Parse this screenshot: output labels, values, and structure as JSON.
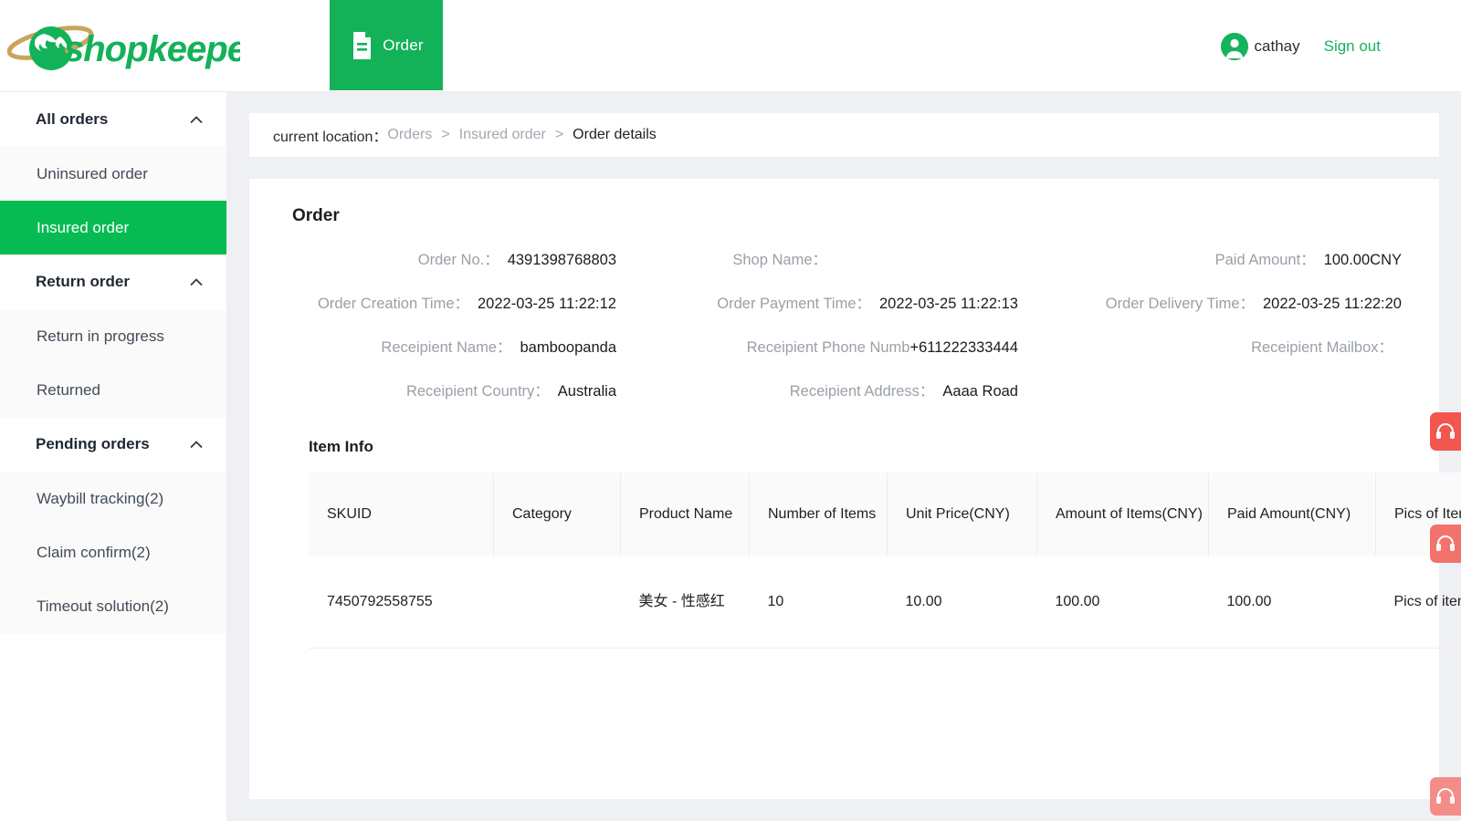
{
  "brand": {
    "name": "shopkeeper",
    "logo_icon": "globe-orbit-logo",
    "green": "#13b259",
    "gold": "#c9a45c"
  },
  "header": {
    "tab": {
      "label": "Order",
      "icon": "document-icon"
    },
    "user": {
      "name": "cathay",
      "avatar_icon": "user-avatar-icon"
    },
    "sign_out": "Sign out"
  },
  "sidebar": {
    "groups": [
      {
        "label": "All orders",
        "icon": "chevron-up-icon",
        "items": [
          {
            "label": "Uninsured order",
            "active": false
          },
          {
            "label": "Insured order",
            "active": true
          }
        ]
      },
      {
        "label": "Return order",
        "icon": "chevron-up-icon",
        "items": [
          {
            "label": "Return in progress",
            "active": false
          },
          {
            "label": "Returned",
            "active": false
          }
        ]
      },
      {
        "label": "Pending orders",
        "icon": "chevron-up-icon",
        "items": [
          {
            "label": "Waybill tracking(2)",
            "active": false
          },
          {
            "label": "Claim confirm(2)",
            "active": false
          },
          {
            "label": "Timeout solution(2)",
            "active": false
          }
        ]
      }
    ]
  },
  "breadcrumb": {
    "prefix": "current location：",
    "items": [
      "Orders",
      "Insured order",
      "Order details"
    ],
    "separator": ">"
  },
  "order_section": {
    "title": "Order",
    "fields": {
      "order_no_label": "Order No.：",
      "order_no_value": "4391398768803",
      "shop_name_label": "Shop Name：",
      "shop_name_value": "",
      "paid_amount_label": "Paid Amount：",
      "paid_amount_value": "100.00CNY",
      "creation_time_label": "Order Creation Time：",
      "creation_time_value": "2022-03-25 11:22:12",
      "payment_time_label": "Order Payment Time：",
      "payment_time_value": "2022-03-25 11:22:13",
      "delivery_time_label": "Order Delivery Time：",
      "delivery_time_value": "2022-03-25 11:22:20",
      "recipient_name_label": "Receipient Name：",
      "recipient_name_value": "bamboopanda",
      "recipient_phone_label": "Receipient Phone Numb",
      "recipient_phone_value": "+611222333444",
      "recipient_mailbox_label": "Receipient Mailbox：",
      "recipient_mailbox_value": "",
      "recipient_country_label": "Receipient Country：",
      "recipient_country_value": "Australia",
      "recipient_address_label": "Receipient Address：",
      "recipient_address_value": "Aaaa Road"
    }
  },
  "item_info": {
    "title": "Item Info",
    "columns": [
      "SKUID",
      "Category",
      "Product Name",
      "Number of Items",
      "Unit Price(CNY)",
      "Amount of Items(CNY)",
      "Paid Amount(CNY)",
      "Pics of Items"
    ],
    "rows": [
      {
        "skuid": "7450792558755",
        "category": "",
        "product_name": "美女 - 性感红",
        "number_of_items": "10",
        "unit_price": "10.00",
        "amount_of_items": "100.00",
        "paid_amount": "100.00",
        "pics_link": "Pics of items"
      }
    ]
  },
  "side_tabs": [
    {
      "icon": "headset-icon",
      "color": "#f2564f"
    },
    {
      "icon": "headset-icon",
      "color": "#f4726c"
    },
    {
      "icon": "headset-icon",
      "color": "#f48c88"
    }
  ]
}
